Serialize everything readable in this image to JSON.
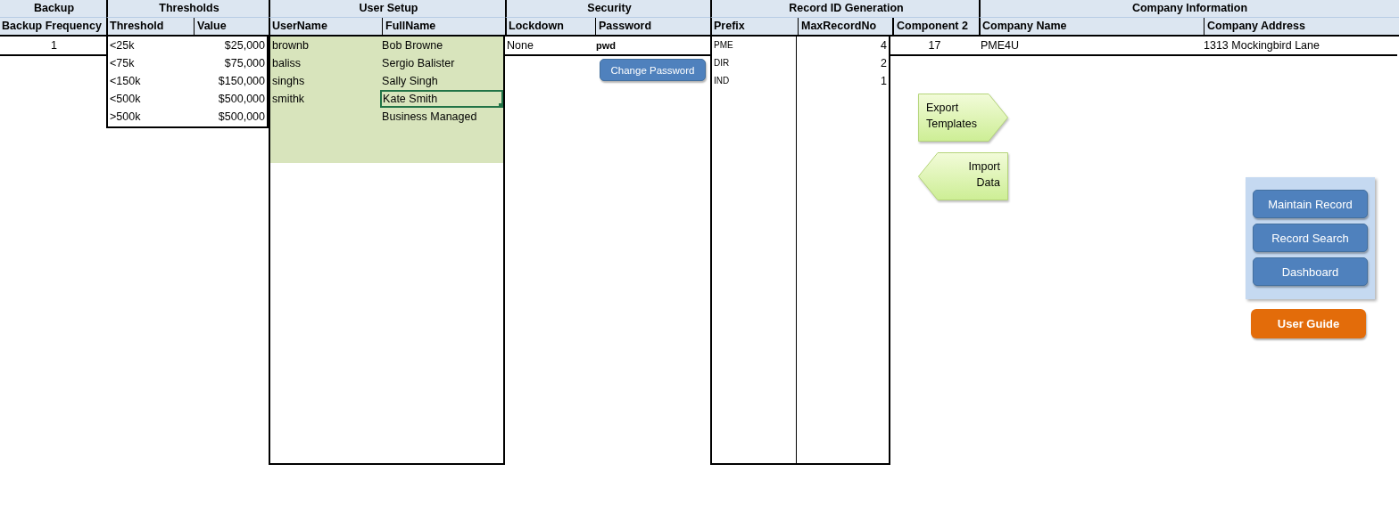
{
  "sections": [
    {
      "title": "Backup",
      "parts": [
        {
          "kind": "record",
          "columns": [
            {
              "label": "Backup Frequency",
              "kind": "count"
            }
          ],
          "rows": [
            [
              "1"
            ]
          ]
        }
      ]
    },
    {
      "title": "Thresholds",
      "parts": [
        {
          "kind": "table",
          "columns": [
            {
              "label": "Threshold",
              "kind": "text"
            },
            {
              "label": "Value",
              "kind": "number"
            }
          ],
          "rows": [
            [
              "<25k",
              "$25,000"
            ],
            [
              "<75k",
              "$75,000"
            ],
            [
              "<150k",
              "$150,000"
            ],
            [
              "<500k",
              "$500,000"
            ],
            [
              ">500k",
              "$500,000"
            ]
          ]
        }
      ]
    },
    {
      "title": "User Setup",
      "parts": [
        {
          "kind": "shaded-panel",
          "columns": [
            {
              "label": "UserName",
              "kind": "text"
            },
            {
              "label": "FullName",
              "kind": "text"
            }
          ],
          "rows": [
            [
              {
                "text": "brownb",
                "selected": false
              },
              {
                "text": "Bob Browne",
                "selected": false
              }
            ],
            [
              {
                "text": "baliss",
                "selected": false
              },
              {
                "text": "Sergio Balister",
                "selected": false
              }
            ],
            [
              {
                "text": "singhs",
                "selected": false
              },
              {
                "text": "Sally Singh",
                "selected": false
              }
            ],
            [
              {
                "text": "smithk",
                "selected": false
              },
              {
                "text": "Kate Smith",
                "selected": true
              }
            ],
            [
              null,
              {
                "text": "Business Managed",
                "selected": false
              }
            ]
          ]
        }
      ]
    },
    {
      "title": "Security",
      "parts": [
        {
          "kind": "record",
          "columns": [
            {
              "label": "Lockdown",
              "kind": "text"
            },
            {
              "label": "Password",
              "kind": "secret"
            }
          ],
          "rows": [
            [
              "None",
              "pwd"
            ]
          ]
        }
      ],
      "button": {
        "label": "Change Password"
      }
    },
    {
      "title": "Record ID Generation",
      "parts": [
        {
          "kind": "panel",
          "columns": [
            {
              "label": "Prefix",
              "kind": "code"
            },
            {
              "label": "MaxRecordNo",
              "kind": "number"
            }
          ],
          "rows": [
            [
              "PME",
              "4"
            ],
            [
              "DIR",
              "2"
            ],
            [
              "IND",
              "1"
            ]
          ]
        },
        {
          "kind": "record",
          "columns": [
            {
              "label": "Component 2",
              "kind": "count"
            }
          ],
          "rows": [
            [
              "17"
            ]
          ]
        }
      ]
    },
    {
      "title": "Company Information",
      "parts": [
        {
          "kind": "record",
          "columns": [
            {
              "label": "Company Name",
              "kind": "text"
            },
            {
              "label": "Company Address",
              "kind": "text"
            }
          ],
          "rows": [
            [
              "PME4U",
              "1313 Mockingbird Lane"
            ]
          ]
        }
      ]
    }
  ],
  "shapes": [
    {
      "kind": "arrow-right",
      "label": "Export Templates"
    },
    {
      "kind": "arrow-left",
      "label": "Import Data"
    }
  ],
  "navigation": {
    "buttons": [
      "Maintain Record",
      "Record Search",
      "Dashboard"
    ]
  },
  "user_guide": {
    "label": "User Guide"
  }
}
